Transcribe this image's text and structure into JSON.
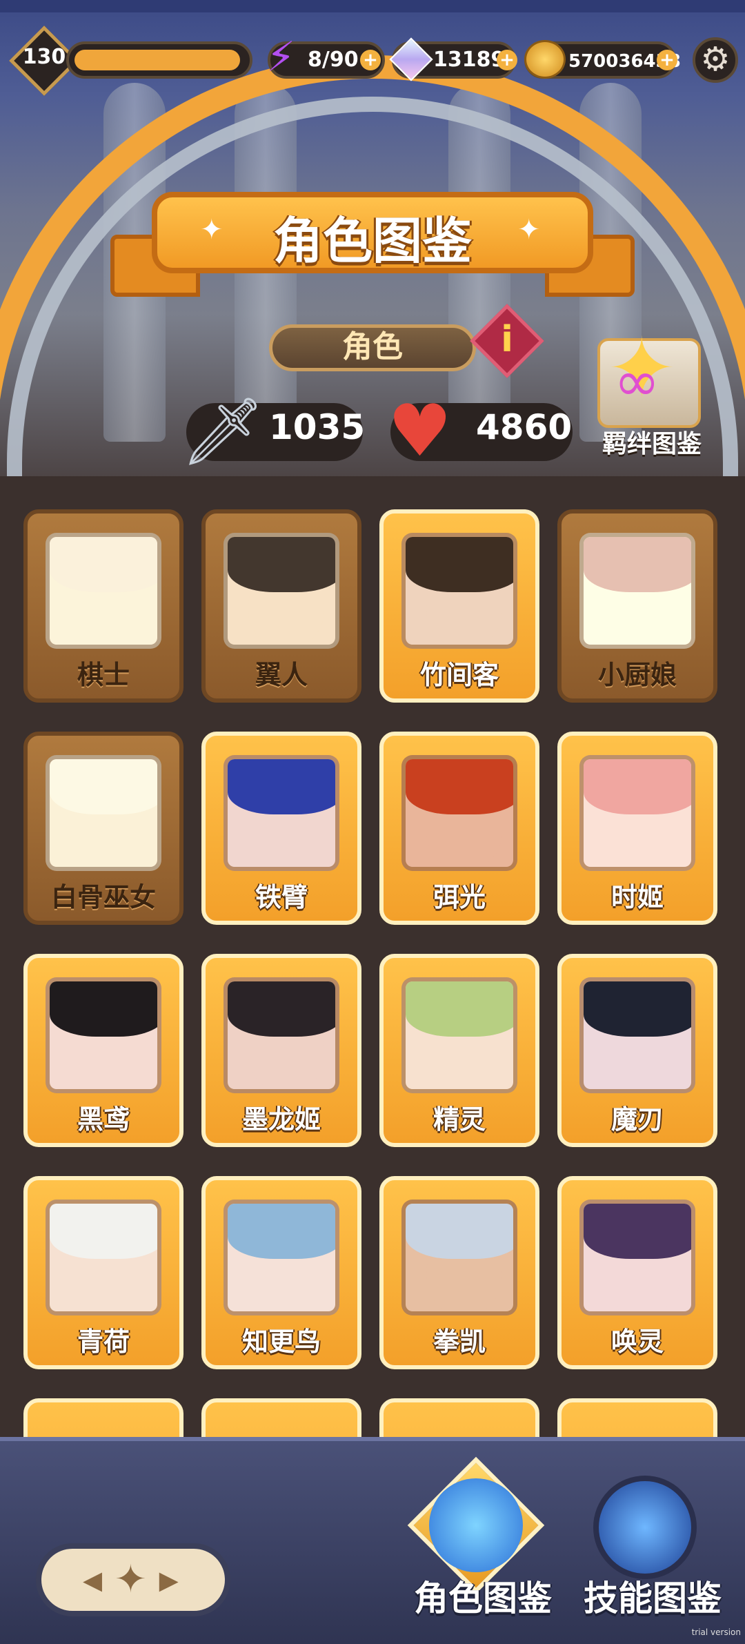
{
  "hud": {
    "level": "130",
    "energy": "8/90",
    "diamonds": "13189",
    "gold": "570036438",
    "plus": "+",
    "settings_icon": "⚙"
  },
  "header": {
    "title": "角色图鉴",
    "tab_label": "角色",
    "info_label": "i"
  },
  "stats": {
    "attack": "1035",
    "health": "4860"
  },
  "bond": {
    "label": "羁绊图鉴"
  },
  "cards": [
    {
      "name": "棋士",
      "owned": false,
      "hair": "#d9d9d9",
      "skin": "#f1d9cc"
    },
    {
      "name": "翼人",
      "owned": false,
      "hair": "#4a2c22",
      "skin": "#e7c6ae"
    },
    {
      "name": "竹间客",
      "owned": true,
      "hair": "#3e2e22",
      "skin": "#efd3bd"
    },
    {
      "name": "小厨娘",
      "owned": false,
      "hair": "#f19aa5",
      "skin": "#fde4dc"
    },
    {
      "name": "白骨巫女",
      "owned": false,
      "hair": "#d6e2e8",
      "skin": "#efd6c8"
    },
    {
      "name": "铁臂",
      "owned": true,
      "hair": "#2f3fa8",
      "skin": "#f1d6cf"
    },
    {
      "name": "弭光",
      "owned": true,
      "hair": "#c9401f",
      "skin": "#e9b59a"
    },
    {
      "name": "时姬",
      "owned": true,
      "hair": "#f0a6a0",
      "skin": "#fbe1d6"
    },
    {
      "name": "黑鸢",
      "owned": true,
      "hair": "#1f1b1d",
      "skin": "#f5dbd2"
    },
    {
      "name": "墨龙姬",
      "owned": true,
      "hair": "#2a2327",
      "skin": "#efd1c5"
    },
    {
      "name": "精灵",
      "owned": true,
      "hair": "#b7cf82",
      "skin": "#f7e1cf"
    },
    {
      "name": "魔刃",
      "owned": true,
      "hair": "#1f2332",
      "skin": "#eed8dc"
    },
    {
      "name": "青荷",
      "owned": true,
      "hair": "#f2f2ee",
      "skin": "#f6e1d2"
    },
    {
      "name": "知更鸟",
      "owned": true,
      "hair": "#8fb7d8",
      "skin": "#f5e1d8"
    },
    {
      "name": "拳凯",
      "owned": true,
      "hair": "#c9d4e2",
      "skin": "#e7bfa2"
    },
    {
      "name": "唤灵",
      "owned": true,
      "hair": "#4b3560",
      "skin": "#f3d9d8"
    }
  ],
  "bottom": {
    "nav_roles": "角色图鉴",
    "nav_skills": "技能图鉴"
  },
  "watermark": "trial version",
  "colors": {
    "accent": "#f3a02a",
    "locked": "#8b5a2b",
    "floor": "#3b302d"
  }
}
